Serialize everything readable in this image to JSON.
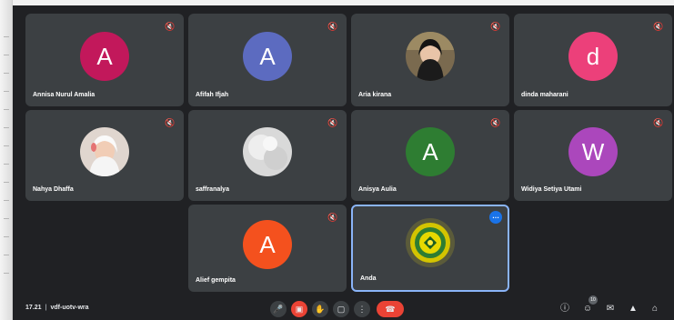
{
  "participants": [
    {
      "name": "Annisa Nurul Amalia",
      "initial": "A",
      "color": "#c2185b",
      "type": "avatar"
    },
    {
      "name": "Afifah Ifjah",
      "initial": "A",
      "color": "#5c6bc0",
      "type": "avatar"
    },
    {
      "name": "Aria kirana",
      "type": "photo"
    },
    {
      "name": "dinda maharani",
      "initial": "d",
      "color": "#ec407a",
      "type": "avatar"
    },
    {
      "name": "Nahya Dhaffa",
      "type": "photo"
    },
    {
      "name": "saffranalya",
      "type": "photo"
    },
    {
      "name": "Anisya Aulia",
      "initial": "A",
      "color": "#2e7d32",
      "type": "avatar"
    },
    {
      "name": "Widiya Setiya Utami",
      "initial": "W",
      "color": "#ab47bc",
      "type": "avatar"
    },
    {
      "name": "Alief gempita",
      "initial": "A",
      "color": "#f4511e",
      "type": "avatar"
    },
    {
      "name": "Anda",
      "type": "logo"
    }
  ],
  "meeting": {
    "time": "17.21",
    "code": "vdf-uotv-wra"
  },
  "people_count": "10",
  "icons": {
    "mic": "mic-off-icon",
    "camera": "camera-off-icon",
    "hand": "raise-hand-icon",
    "present": "present-screen-icon",
    "more": "more-options-icon",
    "end": "end-call-icon",
    "info": "info-icon",
    "people": "people-icon",
    "chat": "chat-icon",
    "activities": "activities-icon",
    "lock": "host-controls-icon"
  }
}
